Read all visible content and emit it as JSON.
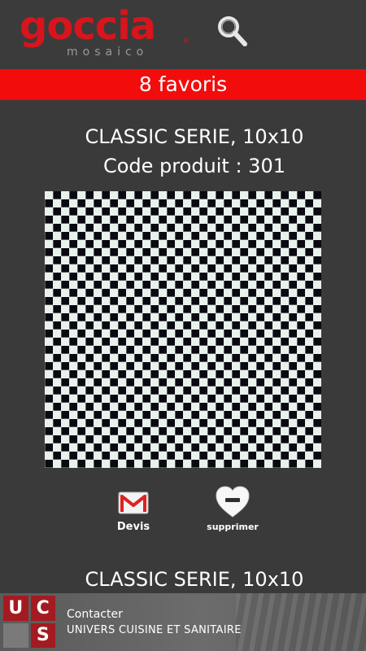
{
  "header": {
    "logo_main": "goccia",
    "logo_sub": "mosaico",
    "logo_reg": "®",
    "search_icon": "magnifier-icon"
  },
  "favorites": {
    "label": "8 favoris"
  },
  "products": [
    {
      "title": "CLASSIC SERIE, 10x10",
      "code": "Code produit : 301",
      "pattern": "black-white-checker-mosaic",
      "actions": {
        "devis_label": "Devis",
        "devis_icon": "gmail-envelope-icon",
        "delete_label": "supprimer",
        "delete_icon": "heart-minus-icon"
      }
    },
    {
      "title": "CLASSIC SERIE, 10x10"
    }
  ],
  "ad": {
    "logo_letters": [
      "U",
      "C",
      "",
      "S"
    ],
    "line1": "Contacter",
    "line2": "UNIVERS CUISINE ET SANITAIRE"
  },
  "colors": {
    "background": "#3a3a3a",
    "brand_red": "#d8141c",
    "fav_bar": "#f20c0c"
  }
}
